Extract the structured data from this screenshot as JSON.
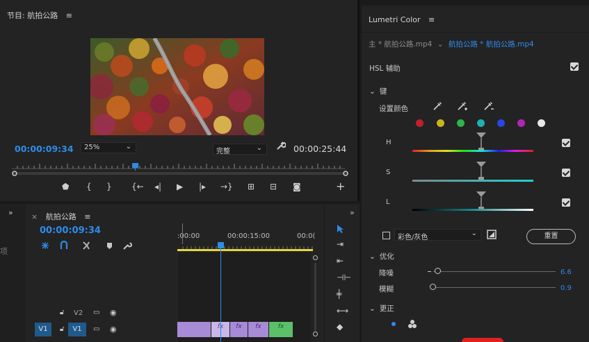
{
  "program": {
    "title": "节目: 航拍公路",
    "menu_icon": "≡",
    "timecode_current": "00:00:09:34",
    "zoom": "25%",
    "quality": "完整",
    "timecode_duration": "00:00:25:44",
    "playhead_position": 0.37
  },
  "transport": {
    "buttons": [
      "add-marker",
      "mark-in",
      "mark-out",
      "go-to-in",
      "step-back",
      "play",
      "step-forward",
      "go-to-out",
      "insert",
      "overwrite",
      "export-frame",
      "add"
    ]
  },
  "timeline": {
    "tab_label": "航拍公路",
    "close_icon": "×",
    "menu_icon": "≡",
    "timecode": "00:00:09:34",
    "left_char": "项",
    "ruler_labels": [
      ":00:00",
      "00:00:15:00",
      "00:0("
    ],
    "tracks": [
      {
        "name": "V2",
        "source": ""
      },
      {
        "name": "V1",
        "source": "V1"
      }
    ],
    "clip_labels": [
      "fx",
      "fx",
      "fx",
      "fx"
    ],
    "collapse_icon": "»"
  },
  "lumetri": {
    "title": "Lumetri Color",
    "menu_icon": "≡",
    "source_master": "主 * 航拍公路.mp4",
    "source_clip": "航拍公路 * 航拍公路.mp4",
    "hsl_label": "HSL 辅助",
    "hsl_enabled": true,
    "key_section": "键",
    "set_color_label": "设置颜色",
    "swatches": [
      "#c0202a",
      "#c9b51a",
      "#2fb34a",
      "#1fb0b0",
      "#2747e8",
      "#b027b5",
      "#e8e8e8"
    ],
    "h_label": "H",
    "s_label": "S",
    "l_label": "L",
    "h_checked": true,
    "s_checked": true,
    "l_checked": true,
    "color_gray_label": "彩色/灰色",
    "reset_label": "重置",
    "refine_section": "优化",
    "denoise_label": "降噪",
    "denoise_value": "6.6",
    "blur_label": "模糊",
    "blur_value": "0.9",
    "correct_section": "更正"
  }
}
